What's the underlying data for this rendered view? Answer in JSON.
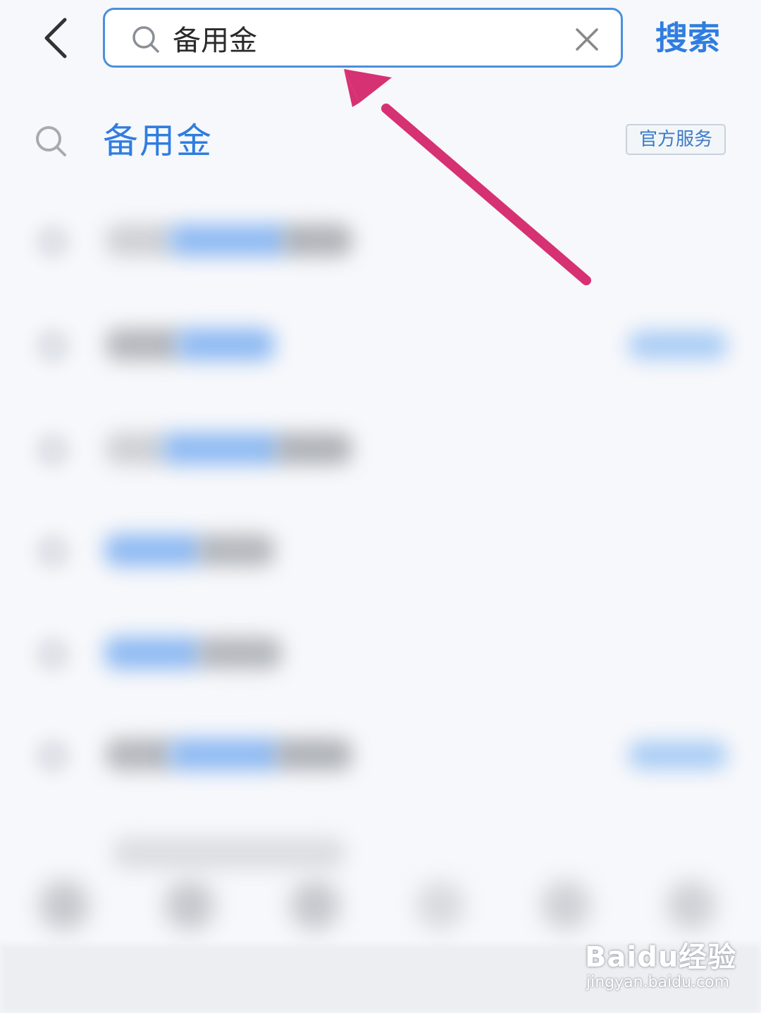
{
  "header": {
    "search_query": "备用金",
    "search_button_label": "搜索"
  },
  "suggestion": {
    "text": "备用金",
    "badge": "官方服务"
  },
  "watermark": {
    "logo_text": "Baidu经验",
    "url": "jingyan.baidu.com"
  },
  "colors": {
    "accent": "#2f7de0",
    "annotation_arrow": "#d63173"
  },
  "icons": [
    "back-chevron-icon",
    "search-icon",
    "clear-icon",
    "search-suggestion-icon"
  ]
}
